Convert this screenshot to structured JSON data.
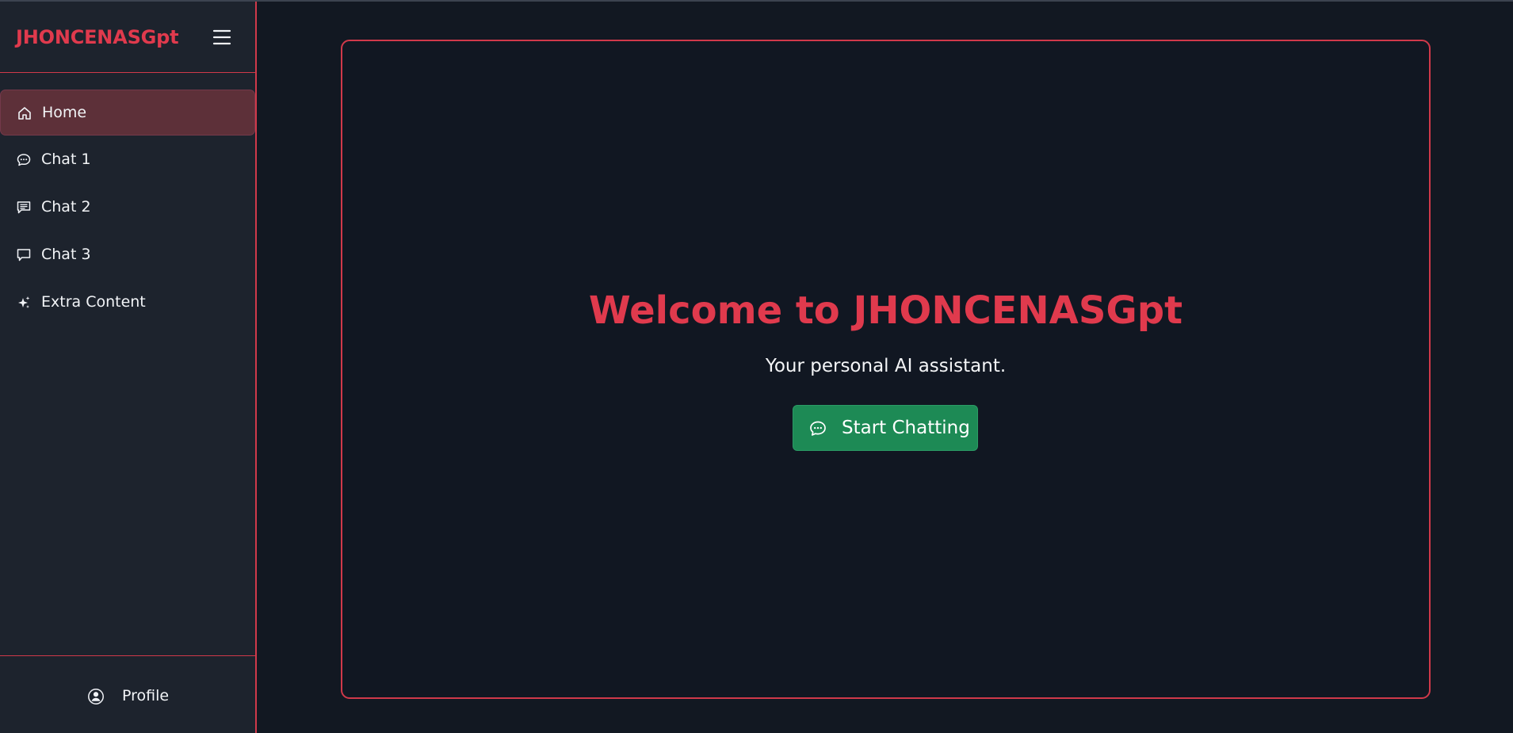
{
  "app": {
    "brand": "JHONCENASGpt"
  },
  "sidebar": {
    "items": [
      {
        "label": "Home",
        "icon": "home-icon",
        "active": true
      },
      {
        "label": "Chat 1",
        "icon": "chat-dots-icon",
        "active": false
      },
      {
        "label": "Chat 2",
        "icon": "chat-text-icon",
        "active": false
      },
      {
        "label": "Chat 3",
        "icon": "chat-square-icon",
        "active": false
      },
      {
        "label": "Extra Content",
        "icon": "sparkles-icon",
        "active": false
      }
    ],
    "footer": {
      "label": "Profile",
      "icon": "profile-icon"
    }
  },
  "main": {
    "title": "Welcome to JHONCENASGpt",
    "subtitle": "Your personal AI assistant.",
    "button": {
      "label": "Start Chatting",
      "icon": "chat-dots-icon"
    }
  },
  "colors": {
    "accent": "#e03a4d",
    "sidebar": "#1d232d",
    "background": "#121822",
    "active_item": "#5d3039",
    "button": "#1d8a55"
  }
}
